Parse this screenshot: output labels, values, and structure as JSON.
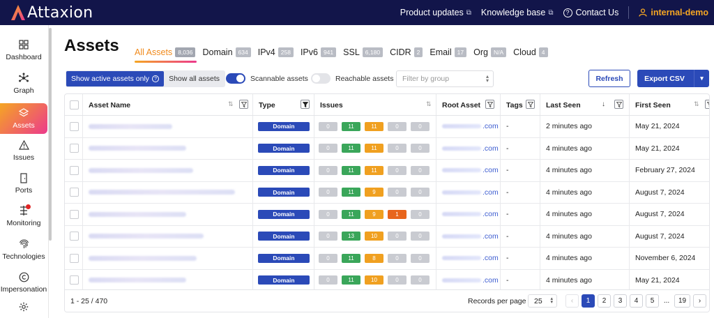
{
  "app": {
    "brand": "Attaxion"
  },
  "topnav": {
    "product_updates": "Product updates",
    "knowledge_base": "Knowledge base",
    "contact_us": "Contact Us",
    "user": "internal-demo"
  },
  "sidebar": {
    "items": [
      {
        "label": "Dashboard",
        "icon": "dashboard-icon"
      },
      {
        "label": "Graph",
        "icon": "graph-icon"
      },
      {
        "label": "Assets",
        "icon": "assets-icon"
      },
      {
        "label": "Issues",
        "icon": "warning-icon"
      },
      {
        "label": "Ports",
        "icon": "door-icon"
      },
      {
        "label": "Monitoring",
        "icon": "monitoring-icon"
      },
      {
        "label": "Technologies",
        "icon": "fingerprint-icon"
      },
      {
        "label": "Impersonation",
        "icon": "copyright-icon"
      }
    ]
  },
  "page": {
    "title": "Assets"
  },
  "tabs": [
    {
      "label": "All Assets",
      "count": "8,036"
    },
    {
      "label": "Domain",
      "count": "634"
    },
    {
      "label": "IPv4",
      "count": "258"
    },
    {
      "label": "IPv6",
      "count": "941"
    },
    {
      "label": "SSL",
      "count": "6,180"
    },
    {
      "label": "CIDR",
      "count": "2"
    },
    {
      "label": "Email",
      "count": "17"
    },
    {
      "label": "Org",
      "count": "N/A"
    },
    {
      "label": "Cloud",
      "count": "4"
    }
  ],
  "toolbar": {
    "show_active": "Show active assets only",
    "show_all": "Show all assets",
    "scannable": "Scannable assets",
    "reachable": "Reachable assets",
    "group_placeholder": "Filter by group",
    "refresh": "Refresh",
    "export": "Export CSV"
  },
  "table": {
    "headers": {
      "asset_name": "Asset Name",
      "type": "Type",
      "issues": "Issues",
      "root_asset": "Root Asset",
      "tags": "Tags",
      "last_seen": "Last Seen",
      "first_seen": "First Seen"
    },
    "issue_colors": [
      "#c9cbd1",
      "#3aa65a",
      "#f0a020",
      "#c9cbd1",
      "#c9cbd1"
    ],
    "rows": [
      {
        "type": "Domain",
        "issues": [
          "0",
          "11",
          "11",
          "0",
          "0"
        ],
        "root_tld": ".com",
        "tags": "-",
        "last_seen": "2 minutes ago",
        "first_seen": "May 21, 2024"
      },
      {
        "type": "Domain",
        "issues": [
          "0",
          "11",
          "11",
          "0",
          "0"
        ],
        "root_tld": ".com",
        "tags": "-",
        "last_seen": "4 minutes ago",
        "first_seen": "May 21, 2024"
      },
      {
        "type": "Domain",
        "issues": [
          "0",
          "11",
          "11",
          "0",
          "0"
        ],
        "root_tld": ".com",
        "tags": "-",
        "last_seen": "4 minutes ago",
        "first_seen": "February 27, 2024"
      },
      {
        "type": "Domain",
        "issues": [
          "0",
          "11",
          "9",
          "0",
          "0"
        ],
        "root_tld": ".com",
        "tags": "-",
        "last_seen": "4 minutes ago",
        "first_seen": "August 7, 2024"
      },
      {
        "type": "Domain",
        "issues": [
          "0",
          "11",
          "9",
          "1",
          "0"
        ],
        "root_tld": ".com",
        "tags": "-",
        "last_seen": "4 minutes ago",
        "first_seen": "August 7, 2024"
      },
      {
        "type": "Domain",
        "issues": [
          "0",
          "13",
          "10",
          "0",
          "0"
        ],
        "root_tld": ".com",
        "tags": "-",
        "last_seen": "4 minutes ago",
        "first_seen": "August 7, 2024"
      },
      {
        "type": "Domain",
        "issues": [
          "0",
          "11",
          "8",
          "0",
          "0"
        ],
        "root_tld": ".com",
        "tags": "-",
        "last_seen": "4 minutes ago",
        "first_seen": "November 6, 2024"
      },
      {
        "type": "Domain",
        "issues": [
          "0",
          "11",
          "10",
          "0",
          "0"
        ],
        "root_tld": ".com",
        "tags": "-",
        "last_seen": "4 minutes ago",
        "first_seen": "May 21, 2024"
      }
    ]
  },
  "footer": {
    "range": "1 - 25 / 470",
    "records_per_page_label": "Records per page",
    "records_per_page": "25",
    "pages": [
      "1",
      "2",
      "3",
      "4",
      "5",
      "...",
      "19"
    ]
  },
  "colors": {
    "accent": "#2b4ab8",
    "nav_bg": "#12154a",
    "brand_orange": "#f5a623",
    "brand_pink": "#ec3a8c",
    "critical": "#e8651c"
  }
}
